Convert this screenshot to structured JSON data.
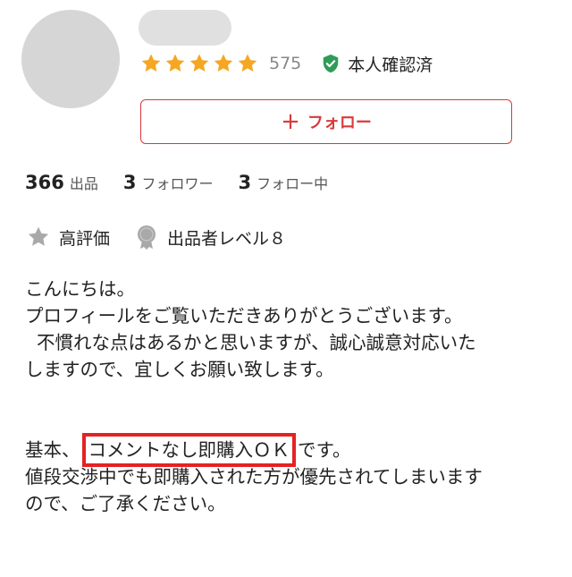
{
  "profile": {
    "rating": {
      "stars_filled": 5,
      "stars_total": 5,
      "count": "575",
      "star_color": "#f5a623"
    },
    "verified": {
      "label": "本人確認済",
      "icon": "shield-check-icon",
      "color": "#2e9d57"
    },
    "follow_button": {
      "icon": "plus-icon",
      "label": "フォロー",
      "color": "#d93a3a"
    }
  },
  "stats": [
    {
      "value": "366",
      "label": "出品"
    },
    {
      "value": "3",
      "label": "フォロワー"
    },
    {
      "value": "3",
      "label": "フォロー中"
    }
  ],
  "badges": [
    {
      "icon": "star-icon",
      "label": "高評価"
    },
    {
      "icon": "medal-icon",
      "label": "出品者レベル８"
    }
  ],
  "bio": {
    "line1": "こんにちは。",
    "line2": "プロフィールをご覧いただきありがとうございます。",
    "line3": "  不慣れな点はあるかと思いますが、誠心誠意対応いた",
    "line4": "しますので、宜しくお願い致します。",
    "line5_prefix": "基本、",
    "line5_highlight": "コメントなし即購入ＯＫ",
    "line5_suffix": "です。",
    "line6": "値段交渉中でも即購入された方が優先されてしまいます",
    "line7": "ので、ご了承ください。",
    "highlight_color": "#e52222"
  }
}
